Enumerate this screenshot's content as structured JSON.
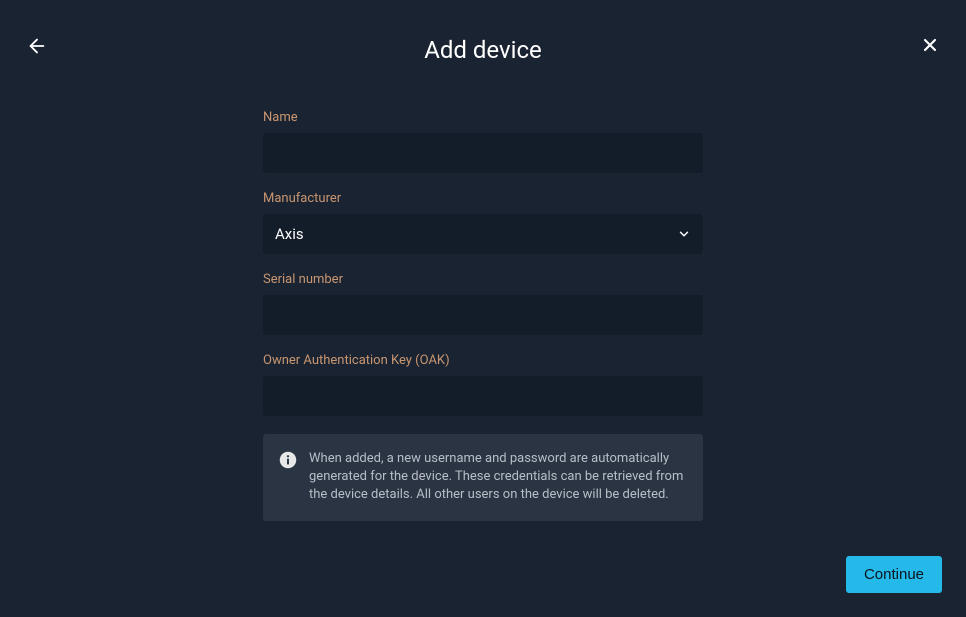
{
  "header": {
    "title": "Add device"
  },
  "form": {
    "name": {
      "label": "Name",
      "value": ""
    },
    "manufacturer": {
      "label": "Manufacturer",
      "selected": "Axis"
    },
    "serial_number": {
      "label": "Serial number",
      "value": ""
    },
    "oak": {
      "label": "Owner Authentication Key (OAK)",
      "value": ""
    }
  },
  "info": {
    "message": "When added, a new username and password are automatically generated for the device. These credentials can be retrieved from the device details. All other users on the device will be deleted."
  },
  "footer": {
    "continue_label": "Continue"
  }
}
